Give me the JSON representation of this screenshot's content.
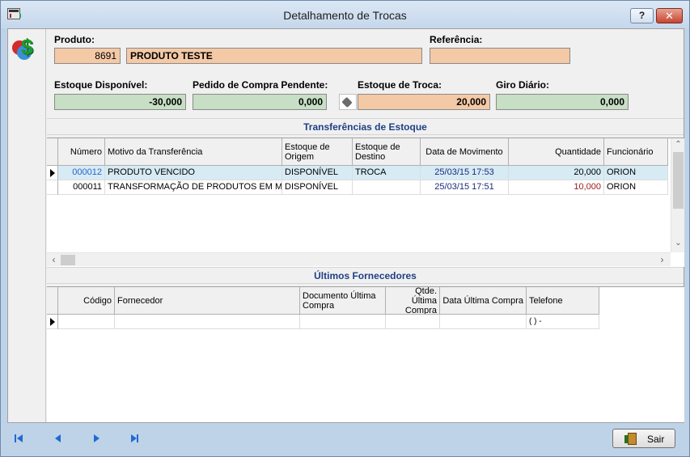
{
  "window": {
    "title": "Detalhamento de Trocas"
  },
  "produto": {
    "label": "Produto:",
    "codigo": "8691",
    "descricao": "PRODUTO TESTE"
  },
  "referencia": {
    "label": "Referência:",
    "value": ""
  },
  "estoque_disponivel": {
    "label": "Estoque Disponível:",
    "value": "-30,000"
  },
  "pedido_compra": {
    "label": "Pedido de Compra Pendente:",
    "value": "0,000"
  },
  "estoque_troca": {
    "label": "Estoque de Troca:",
    "value": "20,000"
  },
  "giro_diario": {
    "label": "Giro Diário:",
    "value": "0,000"
  },
  "transferencias": {
    "title": "Transferências de Estoque",
    "columns": {
      "numero": "Número",
      "motivo": "Motivo da Transferência",
      "origem": "Estoque de Origem",
      "destino": "Estoque de Destino",
      "data": "Data de Movimento",
      "quantidade": "Quantidade",
      "funcionario": "Funcionário"
    },
    "rows": [
      {
        "numero": "000012",
        "motivo": "PRODUTO VENCIDO",
        "origem": "DISPONÍVEL",
        "destino": "TROCA",
        "data": "25/03/15 17:53",
        "quantidade": "20,000",
        "funcionario": "ORION"
      },
      {
        "numero": "000011",
        "motivo": "TRANSFORMAÇÃO DE PRODUTOS EM MA",
        "origem": "DISPONÍVEL",
        "destino": "",
        "data": "25/03/15 17:51",
        "quantidade": "10,000",
        "funcionario": "ORION"
      }
    ]
  },
  "fornecedores": {
    "title": "Últimos Fornecedores",
    "columns": {
      "codigo": "Código",
      "fornecedor": "Fornecedor",
      "documento": "Documento Última Compra",
      "qtde": "Qtde. Última Compra",
      "data": "Data Última Compra",
      "telefone": "Telefone"
    },
    "rows": [
      {
        "codigo": "",
        "fornecedor": "",
        "documento": "",
        "qtde": "",
        "data": "",
        "telefone": "( )  -"
      }
    ]
  },
  "buttons": {
    "sair": "Sair",
    "help": "?",
    "close": "✕"
  },
  "colors": {
    "field_orange": "#f4c9a6",
    "field_green": "#c7dfc5",
    "section_title": "#1f3f84",
    "selected_row": "#d7ebf5",
    "nav_blue": "#1f6ad4",
    "numero_blue": "#2a63c9",
    "data_navy": "#1a2a7a",
    "quantidade_red": "#9a1a1a"
  },
  "icons": [
    "app-icon",
    "help-icon",
    "close-icon",
    "money-icon",
    "search-dot-icon",
    "first-record-icon",
    "prev-record-icon",
    "next-record-icon",
    "last-record-icon",
    "exit-door-icon"
  ]
}
